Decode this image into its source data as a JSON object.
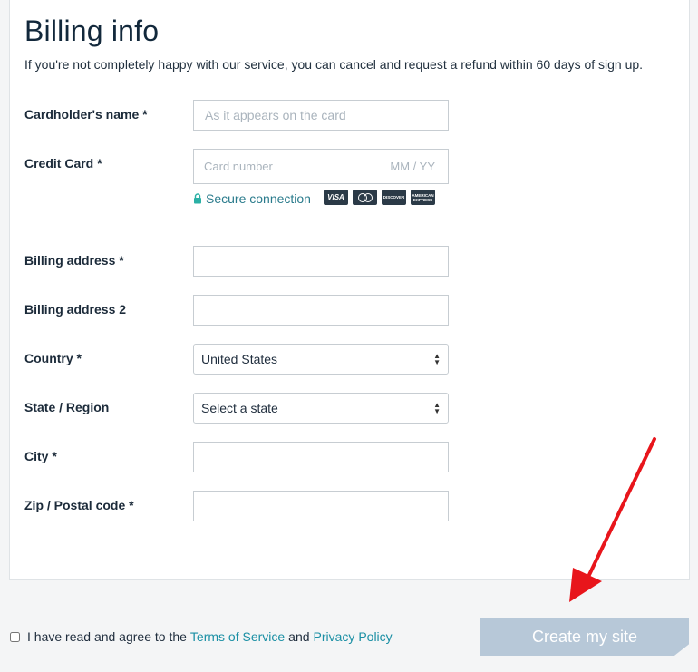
{
  "header": {
    "title": "Billing info",
    "subtitle": "If you're not completely happy with our service, you can cancel and request a refund within 60 days of sign up."
  },
  "form": {
    "cardholder": {
      "label": "Cardholder's name *",
      "placeholder": "As it appears on the card",
      "value": ""
    },
    "credit_card": {
      "label": "Credit Card *",
      "number_placeholder": "Card number",
      "expiry_placeholder": "MM / YY",
      "secure_text": "Secure connection",
      "logos": {
        "visa": "VISA",
        "discover": "DISCOVER",
        "amex": "AMERICAN EXPRESS"
      }
    },
    "address1": {
      "label": "Billing address *",
      "value": ""
    },
    "address2": {
      "label": "Billing address 2",
      "value": ""
    },
    "country": {
      "label": "Country *",
      "selected": "United States"
    },
    "state": {
      "label": "State / Region",
      "selected": "Select a state"
    },
    "city": {
      "label": "City *",
      "value": ""
    },
    "zip": {
      "label": "Zip / Postal code *",
      "value": ""
    }
  },
  "footer": {
    "agree_prefix": "I have read and agree to the",
    "terms_link": "Terms of Service",
    "agree_and": "and",
    "privacy_link": "Privacy Policy",
    "create_button": "Create my site"
  },
  "colors": {
    "accent": "#1a8fa4",
    "button_disabled": "#b7c8d8",
    "arrow": "#e8151b"
  }
}
